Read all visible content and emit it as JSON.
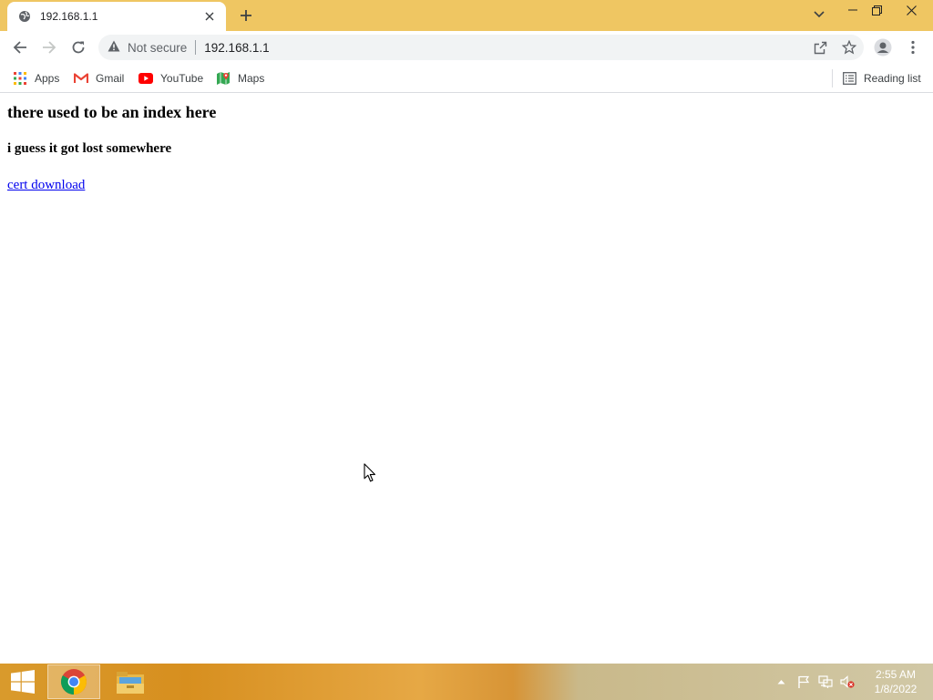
{
  "tab": {
    "title": "192.168.1.1",
    "favicon": "globe-icon",
    "close_icon": "close-icon"
  },
  "window": {
    "new_tab_icon": "plus-icon",
    "tab_search_icon": "chevron-down-icon",
    "minimize_icon": "minimize-icon",
    "restore_icon": "restore-icon",
    "close_icon": "close-icon"
  },
  "toolbar": {
    "security_label": "Not secure",
    "url": "192.168.1.1",
    "icons": [
      "back-arrow-icon",
      "forward-arrow-icon",
      "reload-icon",
      "warning-icon",
      "share-icon",
      "star-icon",
      "profile-icon",
      "kebab-menu-icon"
    ]
  },
  "bookmarks": {
    "items": [
      {
        "label": "Apps",
        "icon": "apps-grid-icon"
      },
      {
        "label": "Gmail",
        "icon": "gmail-icon"
      },
      {
        "label": "YouTube",
        "icon": "youtube-icon"
      },
      {
        "label": "Maps",
        "icon": "maps-icon"
      }
    ],
    "reading_list": {
      "label": "Reading list",
      "icon": "reading-list-icon"
    }
  },
  "page": {
    "heading": "there used to be an index here",
    "subheading": "i guess it got lost somewhere",
    "link_text": "cert download"
  },
  "taskbar": {
    "apps": [
      "windows-start-icon",
      "chrome-icon",
      "file-explorer-icon"
    ],
    "tray_icons": [
      "tray-chevron-up-icon",
      "flag-icon",
      "network-icon",
      "speaker-muted-icon"
    ],
    "time": "2:55 AM",
    "date": "1/8/2022"
  },
  "colors": {
    "titlebar": "#efc662",
    "link": "#0000ee",
    "omnibox": "#f1f3f4"
  }
}
